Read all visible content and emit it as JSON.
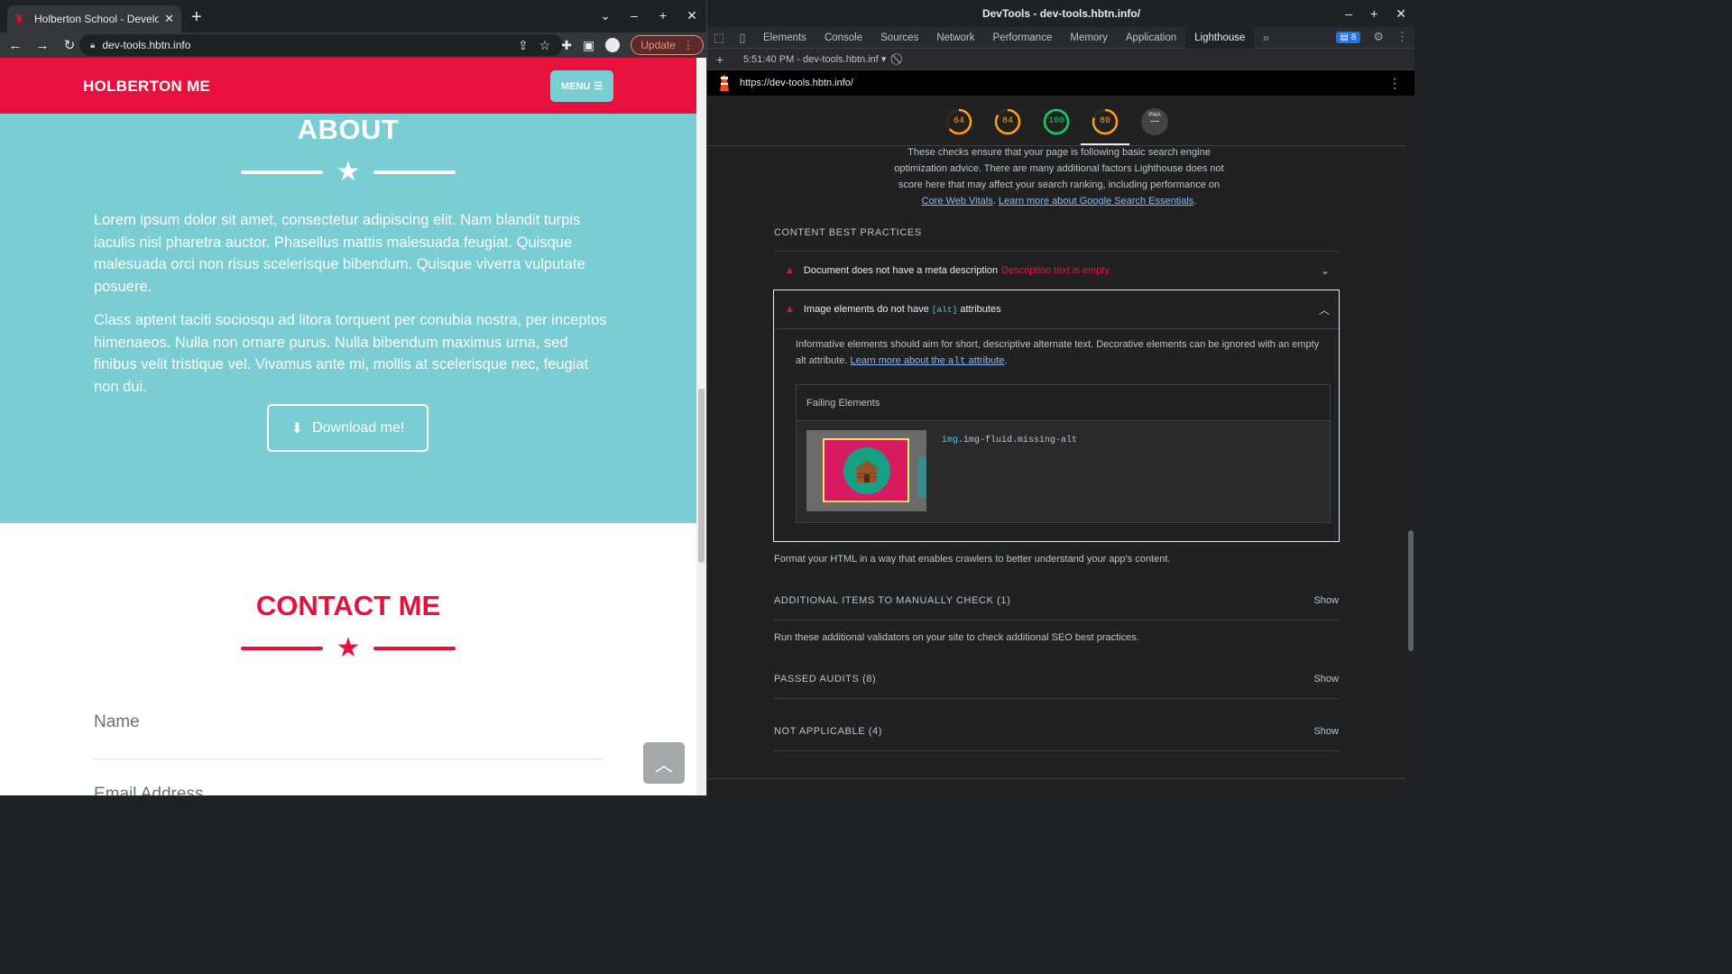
{
  "browser": {
    "tab": {
      "title": "Holberton School - Developer"
    },
    "url": "dev-tools.hbtn.info",
    "update_label": "Update"
  },
  "site": {
    "brand": "HOLBERTON ME",
    "menu_label": "MENU",
    "about": {
      "title": "ABOUT",
      "paragraphs": [
        "Lorem ipsum dolor sit amet, consectetur adipiscing elit. Nam blandit turpis iaculis nisl pharetra auctor. Phasellus mattis malesuada feugiat. Quisque malesuada orci non risus scelerisque bibendum. Quisque viverra vulputate posuere.",
        "Class aptent taciti sociosqu ad litora torquent per conubia nostra, per inceptos himenaeos. Nulla non ornare purus. Nulla bibendum maximus urna, sed finibus velit tristique vel. Vivamus ante mi, mollis at scelerisque nec, feugiat non dui."
      ],
      "download_label": "Download me!"
    },
    "contact": {
      "title": "CONTACT ME",
      "fields": [
        "Name",
        "Email Address"
      ]
    }
  },
  "devtools": {
    "window_title": "DevTools - dev-tools.hbtn.info/",
    "tabs": [
      "Elements",
      "Console",
      "Sources",
      "Network",
      "Performance",
      "Memory",
      "Application",
      "Lighthouse"
    ],
    "active_tab": "Lighthouse",
    "issues_count": "8",
    "report_select": "5:51:40 PM - dev-tools.hbtn.inf",
    "report_url": "https://dev-tools.hbtn.info/",
    "gauges": [
      {
        "score": "64",
        "color": "#ff9f1a"
      },
      {
        "score": "84",
        "color": "#ff9f1a"
      },
      {
        "score": "100",
        "color": "#0cce6b"
      },
      {
        "score": "80",
        "color": "#ff9f1a"
      }
    ],
    "pwa_label": "PWA",
    "seo_desc_text": "These checks ensure that your page is following basic search engine optimization advice. There are many additional factors Lighthouse does not score here that may affect your search ranking, including performance on",
    "seo_link_1": "Core Web Vitals",
    "seo_link_2": "Learn more about Google Search Essentials",
    "group_content": "CONTENT BEST PRACTICES",
    "audit_meta": {
      "title": "Document does not have a meta description",
      "display": "Description text is empty."
    },
    "audit_img": {
      "title_pre": "Image elements do not have",
      "title_code": "[alt]",
      "title_post": "attributes",
      "desc": "Informative elements should aim for short, descriptive alternate text. Decorative elements can be ignored with an empty alt attribute.",
      "link_pre": "Learn more about the",
      "link_code": "alt",
      "link_post": "attribute",
      "failing_header": "Failing Elements",
      "node_tag": "img",
      "node_classes": ".img-fluid.missing-alt"
    },
    "group_footer": "Format your HTML in a way that enables crawlers to better understand your app's content.",
    "manual": {
      "title": "ADDITIONAL ITEMS TO MANUALLY CHECK (1)",
      "desc": "Run these additional validators on your site to check additional SEO best practices."
    },
    "passed": "PASSED AUDITS (8)",
    "not_applicable": "NOT APPLICABLE (4)",
    "show_label": "Show"
  }
}
